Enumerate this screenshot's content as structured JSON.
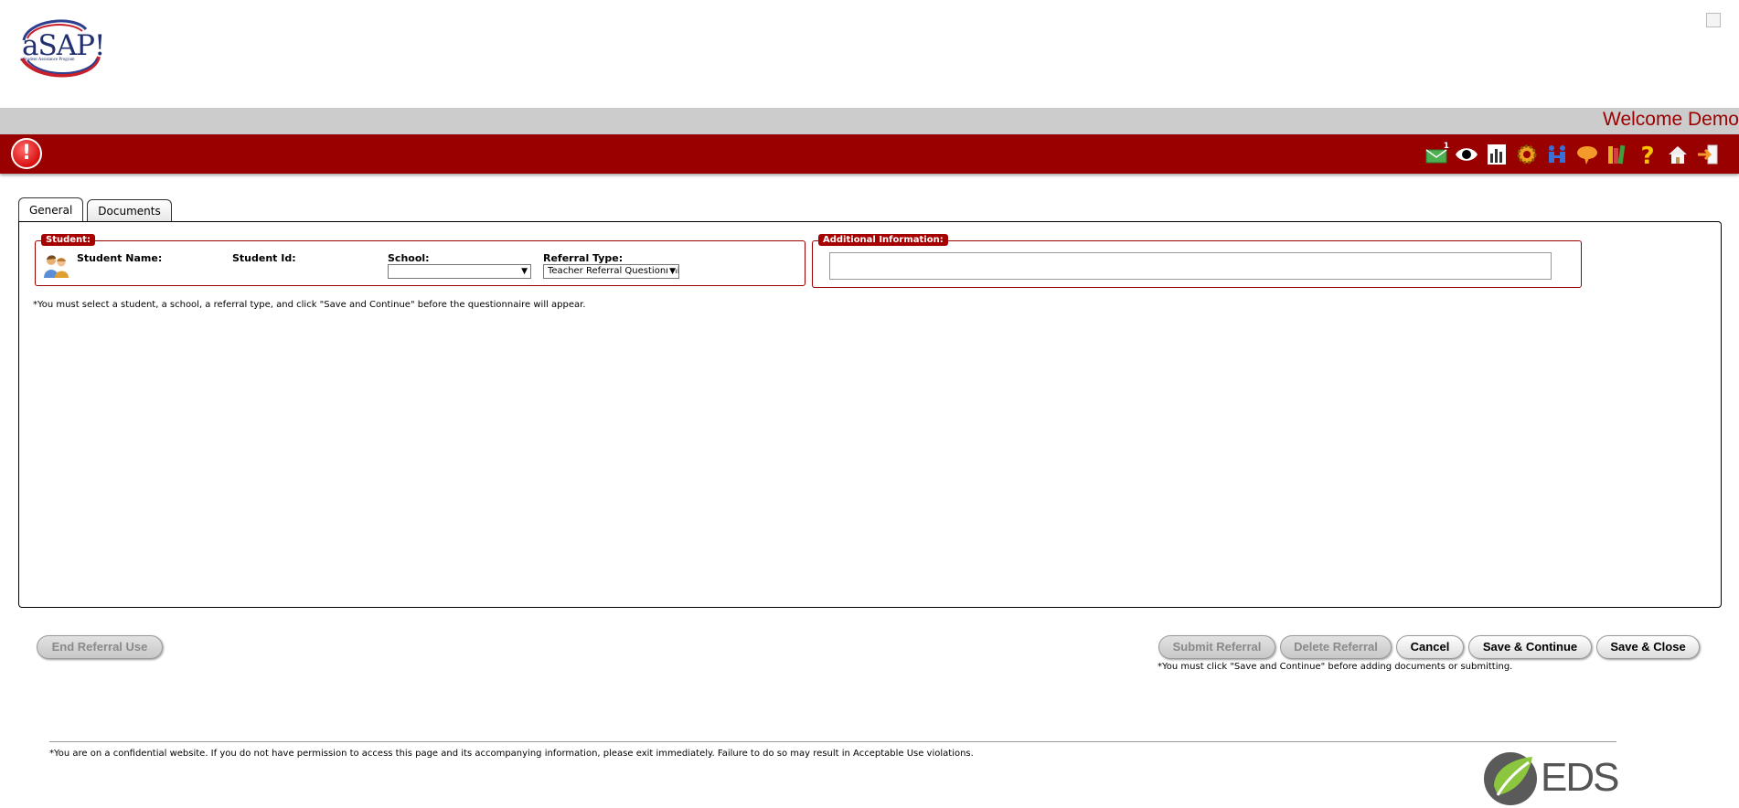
{
  "header": {
    "logo_text": "aSAP!",
    "logo_subtitle": "a Student Assistance Program",
    "welcome": "Welcome Demo",
    "colors": {
      "brand_red": "#990000",
      "grey_bar": "#cccccc"
    }
  },
  "toolbar": {
    "icons": [
      "alert-icon",
      "mail-icon",
      "eye-icon",
      "chart-icon",
      "gear-icon",
      "people-icon",
      "chat-icon",
      "books-icon",
      "help-icon",
      "home-icon",
      "exit-icon"
    ],
    "mail_badge": "1"
  },
  "tabs": [
    {
      "label": "General",
      "active": true
    },
    {
      "label": "Documents",
      "active": false
    }
  ],
  "student": {
    "legend": "Student:",
    "name_label": "Student Name:",
    "id_label": "Student Id:",
    "school_label": "School:",
    "school_value": "",
    "referral_type_label": "Referral Type:",
    "referral_type_value": "Teacher Referral Questionnaire"
  },
  "additional": {
    "legend": "Additional Information:",
    "value": ""
  },
  "notes": {
    "select_note": "*You must select a student, a school, a referral type, and click \"Save and Continue\" before the questionnaire will appear.",
    "save_note": "*You must click \"Save and Continue\" before adding documents or submitting."
  },
  "buttons": {
    "end_referral": "End Referral Use",
    "submit_referral": "Submit Referral",
    "delete_referral": "Delete Referral",
    "cancel": "Cancel",
    "save_continue": "Save & Continue",
    "save_close": "Save & Close"
  },
  "footer": {
    "confidential": "*You are on a confidential website. If you do not have permission to access this page and its accompanying information, please exit immediately. Failure to do so may result in Acceptable Use violations.",
    "logo_text": "EDS"
  }
}
